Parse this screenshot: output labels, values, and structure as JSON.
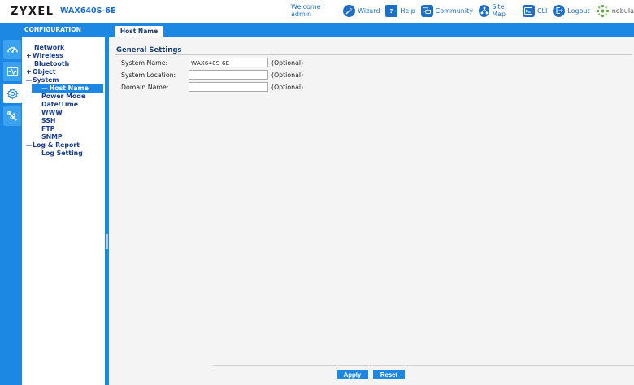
{
  "header": {
    "brand": "ZYXEL",
    "model": "WAX640S-6E",
    "welcome": "Welcome admin",
    "links": [
      {
        "label": "Wizard",
        "icon": "wand-icon"
      },
      {
        "label": "Help",
        "icon": "help-icon"
      },
      {
        "label": "Community",
        "icon": "community-icon"
      },
      {
        "label": "Site Map",
        "icon": "sitemap-icon"
      },
      {
        "label": "CLI",
        "icon": "cli-icon"
      },
      {
        "label": "Logout",
        "icon": "logout-icon"
      }
    ],
    "nebula": "nebula"
  },
  "bar": {
    "config_title": "CONFIGURATION",
    "active_tab": "Host Name"
  },
  "rail": {
    "items": [
      {
        "icon": "dashboard-icon"
      },
      {
        "icon": "monitor-icon"
      },
      {
        "icon": "gear-icon",
        "active": true
      },
      {
        "icon": "maintenance-icon"
      }
    ]
  },
  "tree": {
    "network": "Network",
    "wireless": "Wireless",
    "bluetooth": "Bluetooth",
    "object": "Object",
    "system": "System",
    "host_name": "Host Name",
    "power_mode": "Power Mode",
    "date_time": "Date/Time",
    "www": "WWW",
    "ssh": "SSH",
    "ftp": "FTP",
    "snmp": "SNMP",
    "log_report": "Log & Report",
    "log_setting": "Log Setting",
    "plus": "+",
    "minus": "—",
    "sub_minus": "—"
  },
  "content": {
    "section_title": "General Settings",
    "fields": [
      {
        "label": "System Name:",
        "value": "WAX640S-6E",
        "hint": "(Optional)"
      },
      {
        "label": "System Location:",
        "value": "",
        "hint": "(Optional)"
      },
      {
        "label": "Domain Name:",
        "value": "",
        "hint": "(Optional)"
      }
    ],
    "apply": "Apply",
    "reset": "Reset"
  },
  "colors": {
    "accent": "#1d87e4",
    "brand_blue": "#1d6fc5",
    "tree_text": "#1a3e8f"
  }
}
